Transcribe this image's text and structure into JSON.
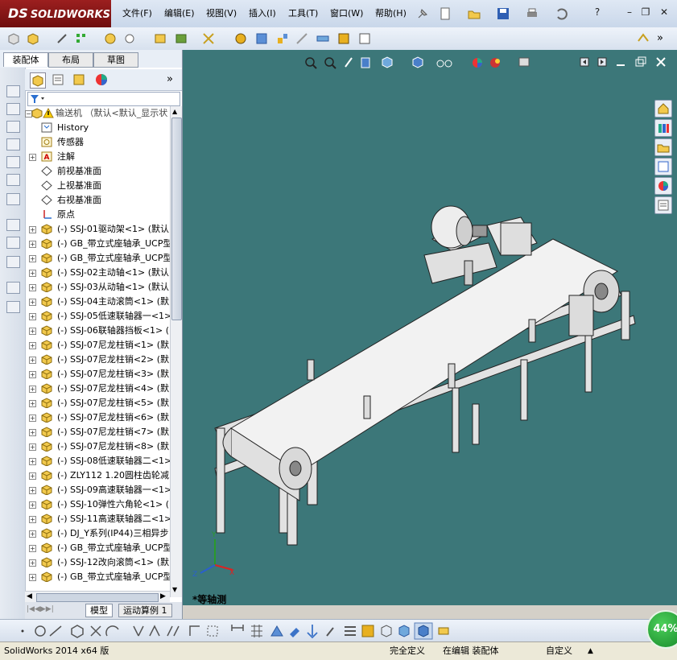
{
  "app": {
    "brand": "SOLIDWORKS",
    "brand_prefix": "DS"
  },
  "menu": [
    "文件(F)",
    "编辑(E)",
    "视图(V)",
    "插入(I)",
    "工具(T)",
    "窗口(W)",
    "帮助(H)"
  ],
  "window_controls": {
    "help": "?",
    "minimize": "–",
    "restore": "❐",
    "close": "✕"
  },
  "left_tabs": [
    "装配体",
    "布局",
    "草图"
  ],
  "filter_icon": "funnel-icon",
  "tree": {
    "root": "输送机 （默认<默认_显示状",
    "items": [
      {
        "label": "History",
        "icon": "history-icon",
        "expand": false
      },
      {
        "label": "传感器",
        "icon": "sensor-icon",
        "expand": false
      },
      {
        "label": "注解",
        "icon": "annotation-icon",
        "expand": true
      },
      {
        "label": "前视基准面",
        "icon": "plane-icon",
        "expand": false
      },
      {
        "label": "上视基准面",
        "icon": "plane-icon",
        "expand": false
      },
      {
        "label": "右视基准面",
        "icon": "plane-icon",
        "expand": false
      },
      {
        "label": "原点",
        "icon": "origin-icon",
        "expand": false
      },
      {
        "label": "(-) SSJ-01驱动架<1> (默认",
        "icon": "part-icon",
        "expand": true
      },
      {
        "label": "(-) GB_带立式座轴承_UCP型",
        "icon": "part-icon",
        "expand": true
      },
      {
        "label": "(-) GB_带立式座轴承_UCP型",
        "icon": "part-icon",
        "expand": true
      },
      {
        "label": "(-) SSJ-02主动轴<1> (默认",
        "icon": "part-icon",
        "expand": true
      },
      {
        "label": "(-) SSJ-03从动轴<1> (默认",
        "icon": "part-icon",
        "expand": true
      },
      {
        "label": "(-) SSJ-04主动滚筒<1> (默",
        "icon": "part-icon",
        "expand": true
      },
      {
        "label": "(-) SSJ-05低速联轴器一<1>",
        "icon": "part-icon",
        "expand": true
      },
      {
        "label": "(-) SSJ-06联轴器挡板<1> (",
        "icon": "part-icon",
        "expand": true
      },
      {
        "label": "(-) SSJ-07尼龙柱销<1> (默",
        "icon": "part-icon",
        "expand": true
      },
      {
        "label": "(-) SSJ-07尼龙柱销<2> (默",
        "icon": "part-icon",
        "expand": true
      },
      {
        "label": "(-) SSJ-07尼龙柱销<3> (默",
        "icon": "part-icon",
        "expand": true
      },
      {
        "label": "(-) SSJ-07尼龙柱销<4> (默",
        "icon": "part-icon",
        "expand": true
      },
      {
        "label": "(-) SSJ-07尼龙柱销<5> (默",
        "icon": "part-icon",
        "expand": true
      },
      {
        "label": "(-) SSJ-07尼龙柱销<6> (默",
        "icon": "part-icon",
        "expand": true
      },
      {
        "label": "(-) SSJ-07尼龙柱销<7> (默",
        "icon": "part-icon",
        "expand": true
      },
      {
        "label": "(-) SSJ-07尼龙柱销<8> (默",
        "icon": "part-icon",
        "expand": true
      },
      {
        "label": "(-) SSJ-08低速联轴器二<1>",
        "icon": "part-icon",
        "expand": true
      },
      {
        "label": "(-) ZLY112 1.20圆柱齿轮减",
        "icon": "part-icon",
        "expand": true
      },
      {
        "label": "(-) SSJ-09高速联轴器一<1>",
        "icon": "part-icon",
        "expand": true
      },
      {
        "label": "(-) SSJ-10弹性六角轮<1> (",
        "icon": "part-icon",
        "expand": true
      },
      {
        "label": "(-) SSJ-11高速联轴器二<1>",
        "icon": "part-icon",
        "expand": true
      },
      {
        "label": "(-) DJ_Y系列(IP44)三相异步",
        "icon": "part-icon",
        "expand": true
      },
      {
        "label": "(-) GB_带立式座轴承_UCP型",
        "icon": "part-icon",
        "expand": true
      },
      {
        "label": "(-) SSJ-12改向滚筒<1> (默",
        "icon": "part-icon",
        "expand": true
      },
      {
        "label": "(-) GB_带立式座轴承_UCP型",
        "icon": "part-icon",
        "expand": true
      }
    ]
  },
  "bottom_tabs": [
    "模型",
    "运动算例 1"
  ],
  "viewport": {
    "view_label": "*等轴测",
    "background": "#3c7779",
    "triad": {
      "x": "X",
      "y": "Y",
      "z": "Z"
    }
  },
  "status": {
    "left": "SolidWorks 2014 x64 版",
    "constraint": "完全定义",
    "editing": "在编辑 装配体",
    "units": "自定义"
  },
  "progress_badge": "44%"
}
